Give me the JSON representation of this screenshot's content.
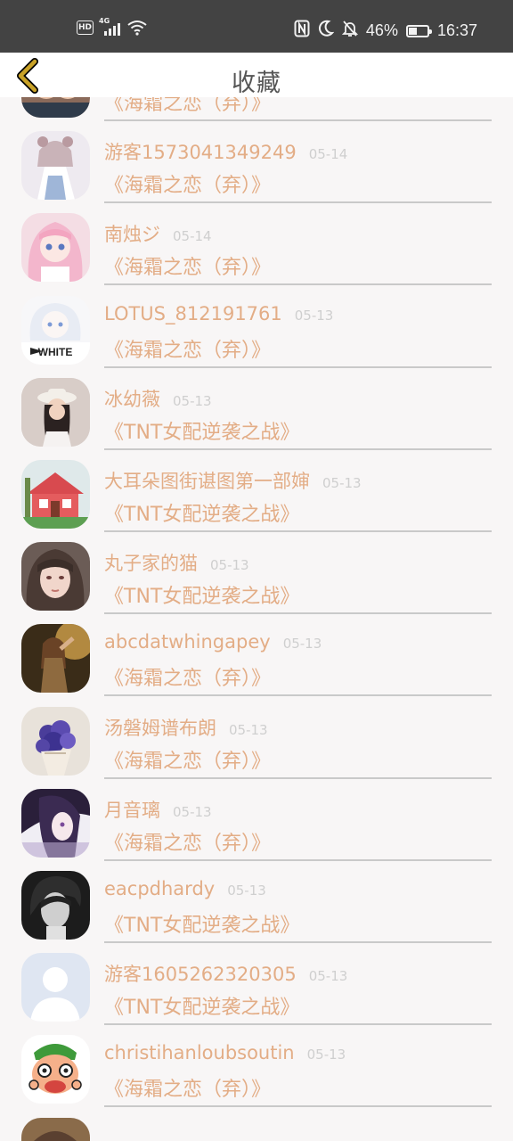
{
  "status_bar": {
    "hd": "HD",
    "network": "4G",
    "battery_percent": "46%",
    "battery_level": 0.46,
    "time": "16:37",
    "icons": [
      "nfc-icon",
      "moon-icon",
      "bell-off-icon",
      "battery-icon"
    ]
  },
  "header": {
    "title": "收藏",
    "back_icon": "chevron-left-icon"
  },
  "colors": {
    "accent": "#e3ad86",
    "date": "#cfcfcf",
    "back": "#c9a227",
    "status_bar": "#434343"
  },
  "items": [
    {
      "name": "",
      "date": "",
      "book": "《海霜之恋（弃）》",
      "avatar": "avatar-girl-friends"
    },
    {
      "name": "游客1573041349249",
      "date": "05-14",
      "book": "《海霜之恋（弃）》",
      "avatar": "avatar-anime-white-dress"
    },
    {
      "name": "南烛ジ",
      "date": "05-14",
      "book": "《海霜之恋（弃）》",
      "avatar": "avatar-anime-pink-hair"
    },
    {
      "name": "LOTUS_812191761",
      "date": "05-13",
      "book": "《海霜之恋（弃）》",
      "avatar": "avatar-anime-white-shirt"
    },
    {
      "name": "冰幼薇",
      "date": "05-13",
      "book": "《TNT女配逆袭之战》",
      "avatar": "avatar-girl-hat"
    },
    {
      "name": "大耳朵图街谌图第一部婶",
      "date": "05-13",
      "book": "《TNT女配逆袭之战》",
      "avatar": "avatar-red-house"
    },
    {
      "name": "丸子家的猫",
      "date": "05-13",
      "book": "《TNT女配逆袭之战》",
      "avatar": "avatar-illustrated-girl"
    },
    {
      "name": "abcdatwhingapey",
      "date": "05-13",
      "book": "《海霜之恋（弃）》",
      "avatar": "avatar-girl-sunset"
    },
    {
      "name": "汤磐姆谱布朗",
      "date": "05-13",
      "book": "《海霜之恋（弃）》",
      "avatar": "avatar-purple-flowers"
    },
    {
      "name": "月音璃",
      "date": "05-13",
      "book": "《海霜之恋（弃）》",
      "avatar": "avatar-anime-purple"
    },
    {
      "name": "eacpdhardy",
      "date": "05-13",
      "book": "《TNT女配逆袭之战》",
      "avatar": "avatar-bw-person"
    },
    {
      "name": "游客1605262320305",
      "date": "05-13",
      "book": "《TNT女配逆袭之战》",
      "avatar": "avatar-default-person"
    },
    {
      "name": "christihanloubsoutin",
      "date": "05-13",
      "book": "《海霜之恋（弃）》",
      "avatar": "avatar-cartoon-zoro"
    },
    {
      "name": "",
      "date": "",
      "book": "",
      "avatar": "avatar-partial"
    }
  ]
}
